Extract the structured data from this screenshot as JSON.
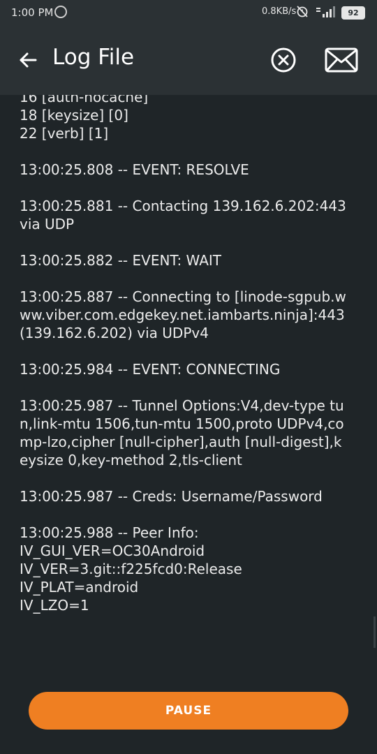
{
  "status_bar": {
    "time": "1:00 PM",
    "speed": "0.8KB/s",
    "battery": "92"
  },
  "app_bar": {
    "title": "Log File"
  },
  "log": {
    "lines": [
      "16 [auth-nocache]",
      "18 [keysize] [0]",
      "22 [verb] [1]",
      "",
      "13:00:25.808 -- EVENT: RESOLVE",
      "",
      "13:00:25.881 -- Contacting 139.162.6.202:443 via UDP",
      "",
      "13:00:25.882 -- EVENT: WAIT",
      "",
      "13:00:25.887 -- Connecting to [linode-sgpub.www.viber.com.edgekey.net.iambarts.ninja]:443 (139.162.6.202) via UDPv4",
      "",
      "13:00:25.984 -- EVENT: CONNECTING",
      "",
      "13:00:25.987 -- Tunnel Options:V4,dev-type tun,link-mtu 1506,tun-mtu 1500,proto UDPv4,comp-lzo,cipher [null-cipher],auth [null-digest],keysize 0,key-method 2,tls-client",
      "",
      "13:00:25.987 -- Creds: Username/Password",
      "",
      "13:00:25.988 -- Peer Info:",
      "IV_GUI_VER=OC30Android",
      "IV_VER=3.git::f225fcd0:Release",
      "IV_PLAT=android",
      "IV_LZO=1"
    ]
  },
  "pause_button": {
    "label": "PAUSE"
  },
  "colors": {
    "accent": "#ef7f22",
    "background": "#1f2528",
    "toolbar": "#2b3134"
  },
  "icons": {
    "back": "arrow-left-icon",
    "clear": "circle-x-icon",
    "send": "envelope-icon"
  }
}
